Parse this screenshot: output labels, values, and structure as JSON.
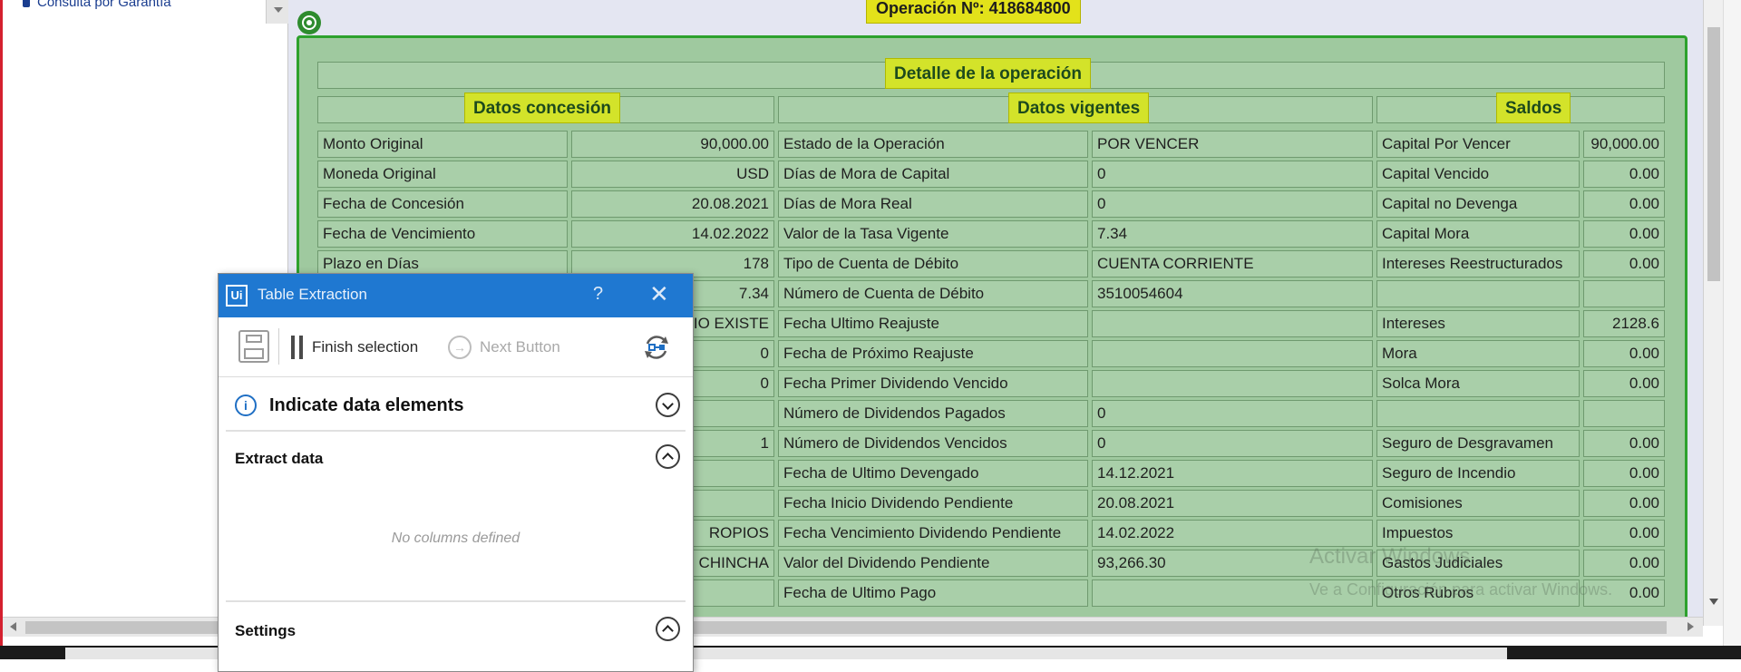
{
  "sidebar": {
    "item_label": "Consulta por Garantía"
  },
  "operation": {
    "title": "Operación Nº: 418684800"
  },
  "table": {
    "main_header": "Detalle de la operación",
    "section_headers": [
      "Datos concesión",
      "Datos vigentes",
      "Saldos"
    ],
    "concesion": [
      {
        "label": "Monto Original",
        "value": "90,000.00"
      },
      {
        "label": "Moneda Original",
        "value": "USD"
      },
      {
        "label": "Fecha de Concesión",
        "value": "20.08.2021"
      },
      {
        "label": "Fecha de Vencimiento",
        "value": "14.02.2022"
      },
      {
        "label": "Plazo en Días",
        "value": "178"
      },
      {
        "label": "",
        "value": "7.34"
      },
      {
        "label": "",
        "value": "IO EXISTE"
      },
      {
        "label": "",
        "value": "0"
      },
      {
        "label": "",
        "value": "0"
      },
      {
        "label": "",
        "value": ""
      },
      {
        "label": "",
        "value": "1"
      },
      {
        "label": "",
        "value": ""
      },
      {
        "label": "",
        "value": ""
      },
      {
        "label": "",
        "value": "ROPIOS"
      },
      {
        "label": "",
        "value": "CHINCHA"
      },
      {
        "label": "",
        "value": ""
      }
    ],
    "vigentes": [
      {
        "label": "Estado de la Operación",
        "value": "POR VENCER"
      },
      {
        "label": "Días de Mora de Capital",
        "value": "0"
      },
      {
        "label": "Días de Mora Real",
        "value": "0"
      },
      {
        "label": "Valor de la Tasa Vigente",
        "value": "7.34"
      },
      {
        "label": "Tipo de Cuenta de Débito",
        "value": "CUENTA CORRIENTE"
      },
      {
        "label": "Número de Cuenta de Débito",
        "value": "3510054604"
      },
      {
        "label": "Fecha Ultimo Reajuste",
        "value": ""
      },
      {
        "label": "Fecha de Próximo Reajuste",
        "value": ""
      },
      {
        "label": "Fecha Primer Dividendo Vencido",
        "value": ""
      },
      {
        "label": "Número de Dividendos Pagados",
        "value": "0"
      },
      {
        "label": "Número de Dividendos Vencidos",
        "value": "0"
      },
      {
        "label": "Fecha de Ultimo Devengado",
        "value": "14.12.2021"
      },
      {
        "label": "Fecha Inicio Dividendo Pendiente",
        "value": "20.08.2021"
      },
      {
        "label": "Fecha Vencimiento Dividendo Pendiente",
        "value": "14.02.2022"
      },
      {
        "label": "Valor del Dividendo Pendiente",
        "value": "93,266.30"
      },
      {
        "label": "Fecha de Ultimo Pago",
        "value": ""
      }
    ],
    "saldos": [
      {
        "label": "Capital Por Vencer",
        "value": "90,000.00"
      },
      {
        "label": "Capital Vencido",
        "value": "0.00"
      },
      {
        "label": "Capital no Devenga",
        "value": "0.00"
      },
      {
        "label": "Capital Mora",
        "value": "0.00"
      },
      {
        "label": "Intereses Reestructurados",
        "value": "0.00"
      },
      {
        "label": "",
        "value": ""
      },
      {
        "label": "Intereses",
        "value": "2128.6"
      },
      {
        "label": "Mora",
        "value": "0.00"
      },
      {
        "label": "Solca Mora",
        "value": "0.00"
      },
      {
        "label": "",
        "value": ""
      },
      {
        "label": "Seguro de Desgravamen",
        "value": "0.00"
      },
      {
        "label": "Seguro de Incendio",
        "value": "0.00"
      },
      {
        "label": "Comisiones",
        "value": "0.00"
      },
      {
        "label": "Impuestos",
        "value": "0.00"
      },
      {
        "label": "Gastos Judiciales",
        "value": "0.00"
      },
      {
        "label": "Otros Rubros",
        "value": "0.00"
      }
    ]
  },
  "watermark": {
    "line1": "Activar Windows",
    "line2": "Ve a Configuración para activar Windows."
  },
  "dialog": {
    "title": "Table Extraction",
    "logo": "Ui",
    "help": "?",
    "close": "✕",
    "finish_label": "Finish selection",
    "next_label": "Next Button",
    "section_indicate": "Indicate data elements",
    "section_extract": "Extract data",
    "empty_text": "No columns defined",
    "section_settings": "Settings",
    "info_glyph": "i",
    "next_glyph": "→"
  },
  "icons": {
    "sidebar": "document-icon",
    "target": "target-icon",
    "save": "save-icon",
    "pause": "pause-icon",
    "next": "next-arrow-icon",
    "refresh": "refresh-icon",
    "info": "info-icon"
  },
  "colors": {
    "dialog_title_bg": "#1f78d1",
    "table_bg": "#a9cfa9",
    "frame_border": "#2da12d",
    "header_bg": "#d3e32a"
  }
}
